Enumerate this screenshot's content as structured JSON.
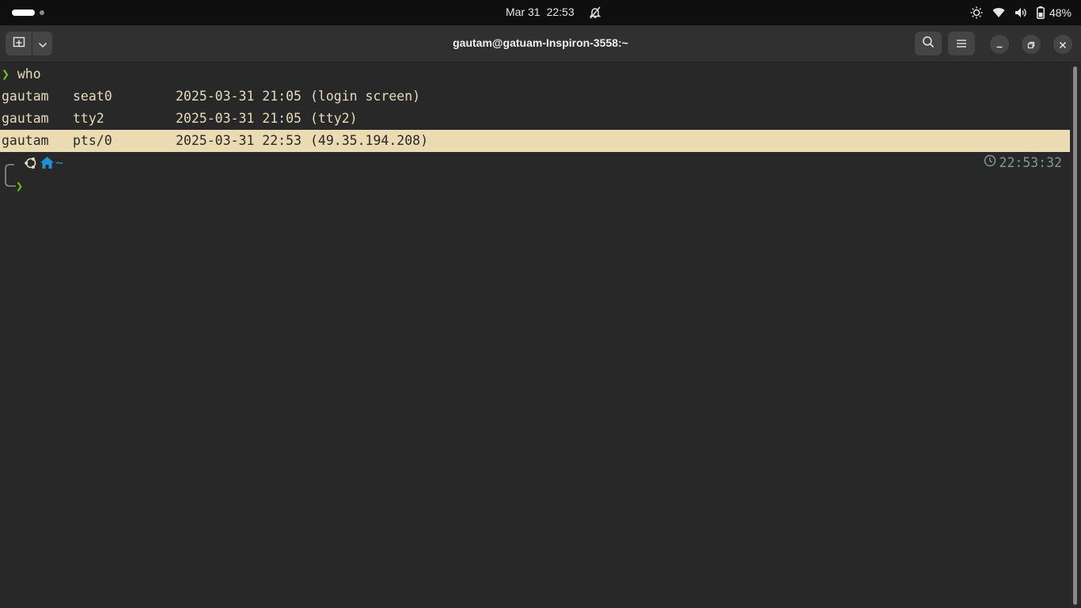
{
  "topbar": {
    "date": "Mar 31",
    "time": "22:53",
    "battery_pct": "48%",
    "icons": [
      "workspace-indicator",
      "bell-muted-icon",
      "brightness-icon",
      "wifi-icon",
      "volume-icon",
      "battery-icon"
    ]
  },
  "header": {
    "title": "gautam@gatuam-Inspiron-3558:~",
    "icons": [
      "new-tab-icon",
      "chevron-down-icon",
      "search-icon",
      "hamburger-menu-icon",
      "minimize-icon",
      "restore-icon",
      "close-icon"
    ]
  },
  "terminal": {
    "prompt_symbol": "❯",
    "command": "who",
    "rows": [
      {
        "user": "gautam",
        "tty": "seat0",
        "datetime": "2025-03-31 21:05",
        "host": "(login screen)"
      },
      {
        "user": "gautam",
        "tty": "tty2",
        "datetime": "2025-03-31 21:05",
        "host": "(tty2)"
      },
      {
        "user": "gautam",
        "tty": "pts/0",
        "datetime": "2025-03-31 22:53",
        "host": "(49.35.194.208)"
      }
    ],
    "cwd": "~",
    "prompt_time": "22:53:32",
    "colors": {
      "background": "#282828",
      "foreground": "#e8dcbc",
      "highlight": "#ebdbb2",
      "prompt_green": "#72c31f",
      "home_blue": "#1e90d6",
      "time_gray": "#80999b"
    }
  }
}
